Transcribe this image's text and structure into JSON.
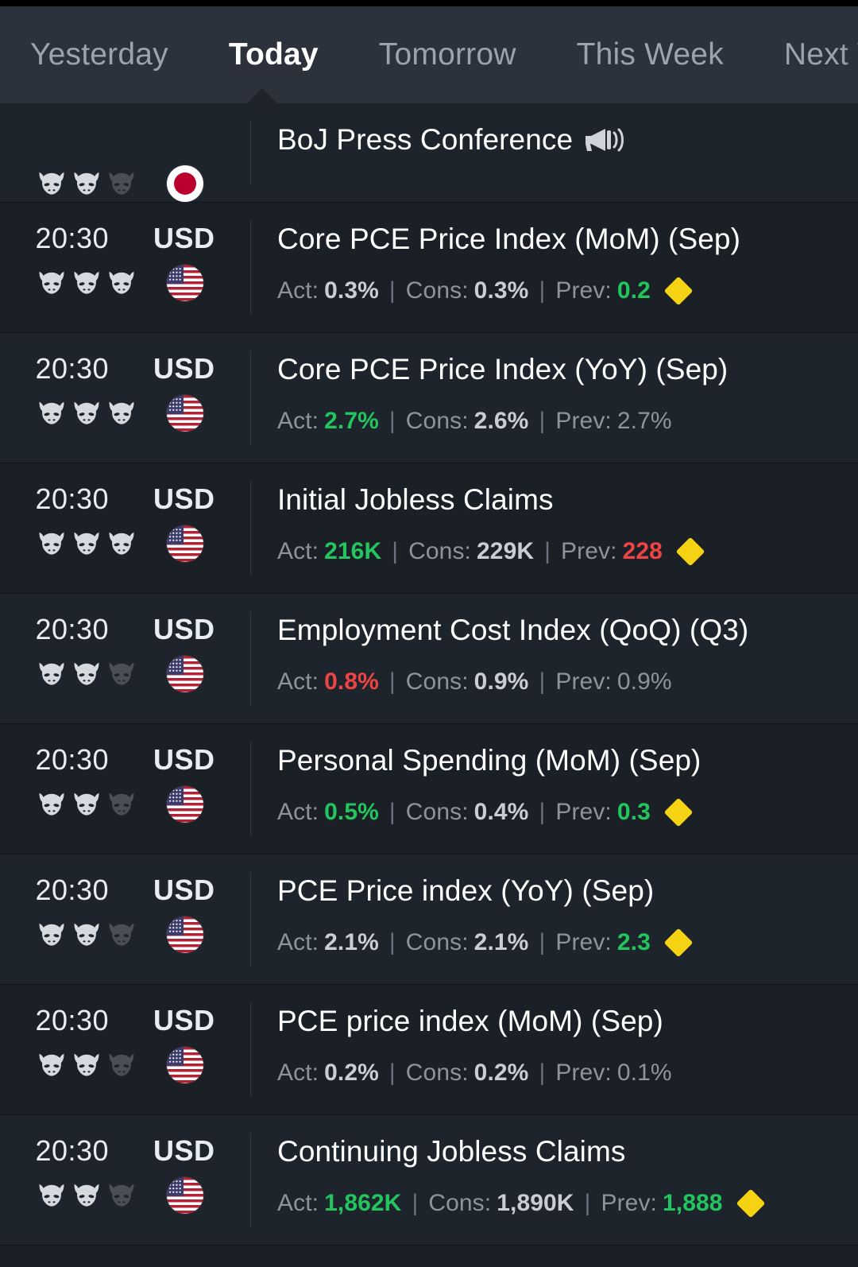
{
  "app": {
    "theme_bg": "#1b2026",
    "tabbar_bg": "#2c323c",
    "accent_up": "#22c55e",
    "accent_down": "#ef4444",
    "accent_badge": "#f5d312"
  },
  "tabs": [
    {
      "label": "Yesterday",
      "active": false
    },
    {
      "label": "Today",
      "active": true
    },
    {
      "label": "Tomorrow",
      "active": false
    },
    {
      "label": "This Week",
      "active": false
    },
    {
      "label": "Next W",
      "active": false
    }
  ],
  "labels": {
    "act": "Act:",
    "cons": "Cons:",
    "prev": "Prev:",
    "sep": "|"
  },
  "events": [
    {
      "time": "",
      "currency": "",
      "flag": "jp-flag-icon",
      "impact_filled": 2,
      "impact_total": 3,
      "title": "BoJ Press Conference",
      "has_speaker_icon": true,
      "has_stats": false,
      "actual": "",
      "actual_state": "",
      "consensus": "",
      "previous": "",
      "previous_state": "",
      "has_badge": false
    },
    {
      "time": "20:30",
      "currency": "USD",
      "flag": "us-flag-icon",
      "impact_filled": 3,
      "impact_total": 3,
      "title": "Core PCE Price Index (MoM) (Sep)",
      "has_speaker_icon": false,
      "has_stats": true,
      "actual": "0.3%",
      "actual_state": "neutral",
      "consensus": "0.3%",
      "previous": "0.2",
      "previous_state": "up",
      "has_badge": true
    },
    {
      "time": "20:30",
      "currency": "USD",
      "flag": "us-flag-icon",
      "impact_filled": 3,
      "impact_total": 3,
      "title": "Core PCE Price Index (YoY) (Sep)",
      "has_speaker_icon": false,
      "has_stats": true,
      "actual": "2.7%",
      "actual_state": "up",
      "consensus": "2.6%",
      "previous": "2.7%",
      "previous_state": "muted",
      "has_badge": false
    },
    {
      "time": "20:30",
      "currency": "USD",
      "flag": "us-flag-icon",
      "impact_filled": 3,
      "impact_total": 3,
      "title": "Initial Jobless Claims",
      "has_speaker_icon": false,
      "has_stats": true,
      "actual": "216K",
      "actual_state": "up",
      "consensus": "229K",
      "previous": "228",
      "previous_state": "down",
      "has_badge": true
    },
    {
      "time": "20:30",
      "currency": "USD",
      "flag": "us-flag-icon",
      "impact_filled": 2,
      "impact_total": 3,
      "title": "Employment Cost Index (QoQ) (Q3)",
      "has_speaker_icon": false,
      "has_stats": true,
      "actual": "0.8%",
      "actual_state": "down",
      "consensus": "0.9%",
      "previous": "0.9%",
      "previous_state": "muted",
      "has_badge": false
    },
    {
      "time": "20:30",
      "currency": "USD",
      "flag": "us-flag-icon",
      "impact_filled": 2,
      "impact_total": 3,
      "title": "Personal Spending (MoM) (Sep)",
      "has_speaker_icon": false,
      "has_stats": true,
      "actual": "0.5%",
      "actual_state": "up",
      "consensus": "0.4%",
      "previous": "0.3",
      "previous_state": "up",
      "has_badge": true
    },
    {
      "time": "20:30",
      "currency": "USD",
      "flag": "us-flag-icon",
      "impact_filled": 2,
      "impact_total": 3,
      "title": "PCE Price index (YoY) (Sep)",
      "has_speaker_icon": false,
      "has_stats": true,
      "actual": "2.1%",
      "actual_state": "neutral",
      "consensus": "2.1%",
      "previous": "2.3",
      "previous_state": "up",
      "has_badge": true
    },
    {
      "time": "20:30",
      "currency": "USD",
      "flag": "us-flag-icon",
      "impact_filled": 2,
      "impact_total": 3,
      "title": "PCE price index (MoM) (Sep)",
      "has_speaker_icon": false,
      "has_stats": true,
      "actual": "0.2%",
      "actual_state": "neutral",
      "consensus": "0.2%",
      "previous": "0.1%",
      "previous_state": "muted",
      "has_badge": false
    },
    {
      "time": "20:30",
      "currency": "USD",
      "flag": "us-flag-icon",
      "impact_filled": 2,
      "impact_total": 3,
      "title": "Continuing Jobless Claims",
      "has_speaker_icon": false,
      "has_stats": true,
      "actual": "1,862K",
      "actual_state": "up",
      "consensus": "1,890K",
      "previous": "1,888",
      "previous_state": "up",
      "has_badge": true
    }
  ]
}
